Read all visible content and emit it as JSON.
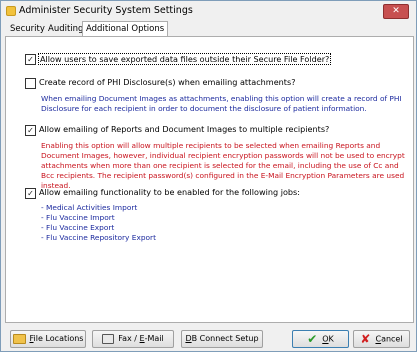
{
  "window": {
    "title": "Administer Security System Settings",
    "close_glyph": "✕"
  },
  "tabs": [
    {
      "label": "Security"
    },
    {
      "label": "Auditing"
    },
    {
      "label": "Additional Options"
    }
  ],
  "options": {
    "allow_save_outside": {
      "label": "Allow users to save exported data files outside their Secure File Folder?",
      "checked": true
    },
    "phi_record": {
      "label": "Create record of PHI Disclosure(s) when emailing attachments?",
      "checked": false,
      "desc": "When emailing Document Images as attachments, enabling this option will create a record of PHI Disclosure for each recipient in order to document the disclosure of patient information."
    },
    "multi_recipients": {
      "label": "Allow emailing of Reports and Document Images to multiple recipients?",
      "checked": true,
      "desc": "Enabling this option will allow multiple recipients to be selected when emailing Reports and Document Images, however, individual recipient encryption passwords will not be used to encrypt attachments when more than one recipient is selected for the email, including the use of Cc and Bcc recipients. The recipient password(s) configured in the E-Mail Encryption Parameters are used instead."
    },
    "email_jobs": {
      "label": "Allow emailing functionality to be enabled for the following jobs:",
      "checked": true,
      "jobs": [
        "- Medical Activities Import",
        "- Flu Vaccine Import",
        "- Flu Vaccine Export",
        "- Flu Vaccine Repository Export"
      ]
    }
  },
  "buttons": {
    "file_locations": {
      "pre": "",
      "ul": "F",
      "post": "ile Locations"
    },
    "fax_email": {
      "pre": "Fax / ",
      "ul": "E",
      "post": "-Mail"
    },
    "db_connect": {
      "pre": "",
      "ul": "D",
      "post": "B Connect Setup"
    },
    "ok": {
      "pre": "",
      "ul": "O",
      "post": "K"
    },
    "cancel": {
      "pre": "",
      "ul": "C",
      "post": "ancel"
    }
  },
  "colors": {
    "info_text": "#1c2a9e",
    "warning_text": "#c8141e",
    "ok_check": "#2a9a2a",
    "cancel_x": "#d11f1f"
  }
}
